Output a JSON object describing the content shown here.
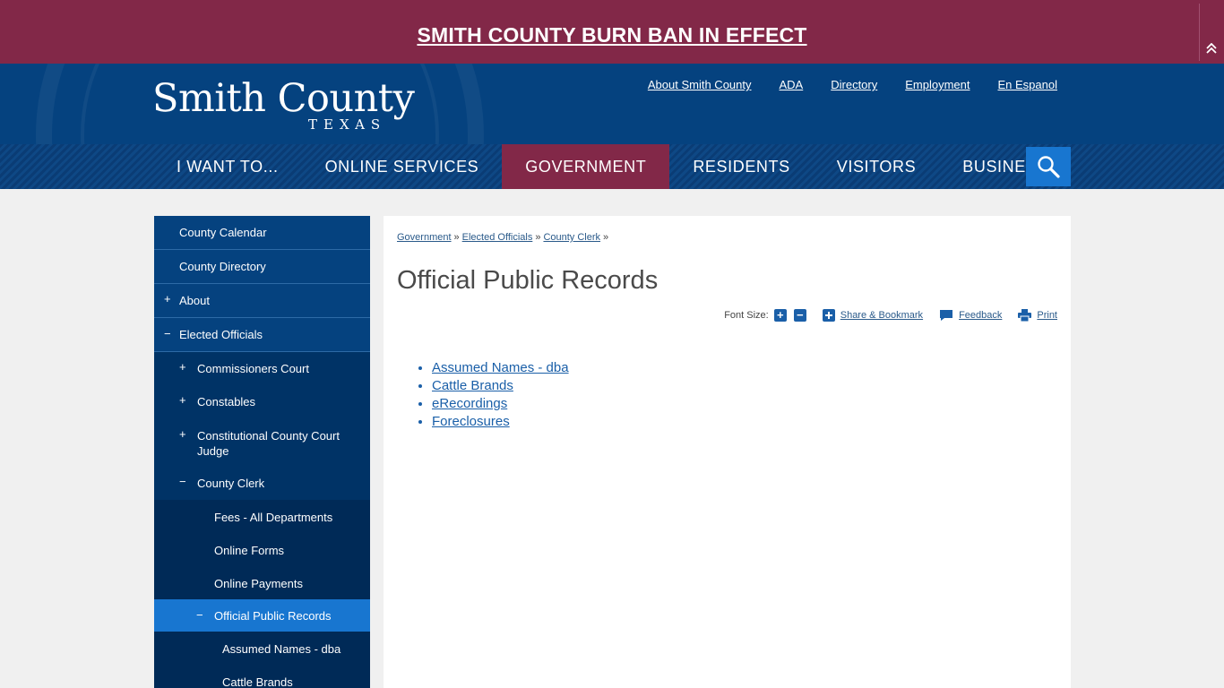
{
  "alert": {
    "text": "SMITH COUNTY BURN BAN IN EFFECT"
  },
  "header": {
    "logo_title": "Smith County",
    "logo_sub": "TEXAS",
    "top_links": [
      "About Smith County",
      "ADA",
      "Directory",
      "Employment",
      "En Espanol"
    ]
  },
  "nav": {
    "items": [
      "I WANT TO...",
      "ONLINE SERVICES",
      "GOVERNMENT",
      "RESIDENTS",
      "VISITORS",
      "BUSINESS"
    ],
    "active": "GOVERNMENT"
  },
  "sidebar": {
    "items": [
      {
        "label": "County Calendar",
        "toggle": ""
      },
      {
        "label": "County Directory",
        "toggle": ""
      },
      {
        "label": "About",
        "toggle": "+"
      },
      {
        "label": "Elected Officials",
        "toggle": "−"
      },
      {
        "label": "Commissioners Court",
        "toggle": "+"
      },
      {
        "label": "Constables",
        "toggle": "+"
      },
      {
        "label": "Constitutional County Court Judge",
        "toggle": "+"
      },
      {
        "label": "County Clerk",
        "toggle": "−"
      },
      {
        "label": "Fees - All Departments",
        "toggle": ""
      },
      {
        "label": "Online Forms",
        "toggle": ""
      },
      {
        "label": "Online Payments",
        "toggle": ""
      },
      {
        "label": "Official Public Records",
        "toggle": "−"
      },
      {
        "label": "Assumed Names - dba",
        "toggle": ""
      },
      {
        "label": "Cattle Brands",
        "toggle": ""
      }
    ]
  },
  "breadcrumb": {
    "items": [
      "Government",
      "Elected Officials",
      "County Clerk"
    ],
    "separator": "»"
  },
  "page": {
    "title": "Official Public Records"
  },
  "tools": {
    "font_size_label": "Font Size:",
    "increase": "+",
    "decrease": "−",
    "share": "Share & Bookmark",
    "feedback": "Feedback",
    "print": "Print"
  },
  "links": [
    "Assumed Names - dba",
    "Cattle Brands",
    "eRecordings",
    "Foreclosures"
  ],
  "colors": {
    "alert": "#822848",
    "header": "#05427f",
    "accent": "#1876d0"
  }
}
